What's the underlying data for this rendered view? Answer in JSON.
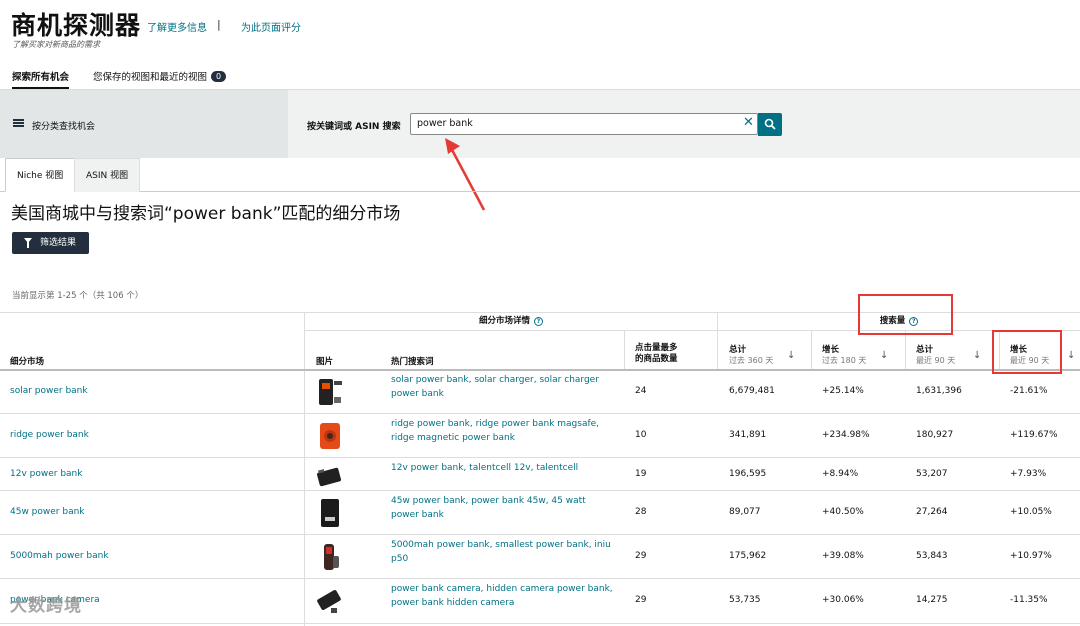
{
  "header": {
    "title": "商机探测器",
    "learn_more": "了解更多信息",
    "separator": "|",
    "rate_page": "为此页面评分",
    "subtitle": "了解买家对新商品的需求"
  },
  "nav": {
    "explore": "探索所有机会",
    "saved": "您保存的视图和最近的视图",
    "saved_count": "0"
  },
  "search": {
    "category_label": "按分类查找机会",
    "label": "按关键词或 ASIN 搜索",
    "value": "power bank"
  },
  "tabs": {
    "niche": "Niche 视图",
    "asin": "ASIN 视图"
  },
  "page": {
    "title": "美国商城中与搜索词“power bank”匹配的细分市场",
    "filter_button": "筛选结果",
    "count": "当前显示第 1-25 个（共 106 个）"
  },
  "table": {
    "group_details": "细分市场详情",
    "group_search": "搜索量",
    "col_niche": "细分市场",
    "col_image": "图片",
    "col_keywords": "热门搜索词",
    "col_clicked_1": "点击量最多",
    "col_clicked_2": "的商品数量",
    "col_total": "总计",
    "col_total_sub": "过去 360 天",
    "col_growth": "增长",
    "col_growth_sub": "过去 180 天",
    "col_total90": "总计",
    "col_total90_sub": "最近 90 天",
    "col_growth90": "增长",
    "col_growth90_sub": "最近 90 天",
    "rows": [
      {
        "niche": "solar power bank",
        "keywords": "solar power bank, solar charger, solar charger power bank",
        "count": "24",
        "total360": "6,679,481",
        "growth180": "+25.14%",
        "total90": "1,631,396",
        "growth90": "-21.61%"
      },
      {
        "niche": "ridge power bank",
        "keywords": "ridge power bank, ridge power bank magsafe, ridge magnetic power bank",
        "count": "10",
        "total360": "341,891",
        "growth180": "+234.98%",
        "total90": "180,927",
        "growth90": "+119.67%"
      },
      {
        "niche": "12v power bank",
        "keywords": "12v power bank, talentcell 12v, talentcell",
        "count": "19",
        "total360": "196,595",
        "growth180": "+8.94%",
        "total90": "53,207",
        "growth90": "+7.93%"
      },
      {
        "niche": "45w power bank",
        "keywords": "45w power bank, power bank 45w, 45 watt power bank",
        "count": "28",
        "total360": "89,077",
        "growth180": "+40.50%",
        "total90": "27,264",
        "growth90": "+10.05%"
      },
      {
        "niche": "5000mah power bank",
        "keywords": "5000mah power bank, smallest power bank, iniu p50",
        "count": "29",
        "total360": "175,962",
        "growth180": "+39.08%",
        "total90": "53,843",
        "growth90": "+10.97%"
      },
      {
        "niche": "power bank camera",
        "keywords": "power bank camera, hidden camera power bank, power bank hidden camera",
        "count": "29",
        "total360": "53,735",
        "growth180": "+30.06%",
        "total90": "14,275",
        "growth90": "-11.35%"
      }
    ]
  },
  "watermark": "大数跨境"
}
